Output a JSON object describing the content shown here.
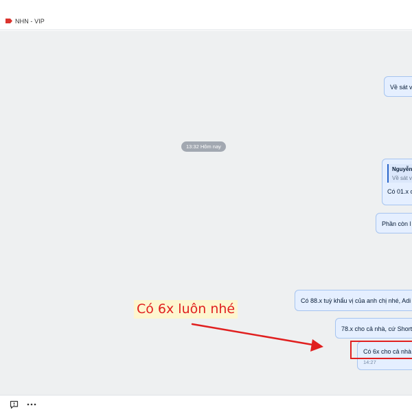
{
  "header": {
    "tag_color": "#db342e",
    "title": "NHN - VIP"
  },
  "chat": {
    "time_separator": "13:32 Hôm nay",
    "messages": [
      {
        "text": "Về sát v"
      },
      {
        "quote_name": "Nguyễn",
        "quote_text": "Về sát v",
        "text": "Có 01.x c"
      },
      {
        "text": "Phần còn l"
      },
      {
        "text": "Có 88.x tuỳ khẩu vị của anh chị nhé, Adi"
      },
      {
        "text": "78.x cho cả nhà, cứ Short"
      },
      {
        "text": "Có 6x cho cả nhà",
        "time": "14:27"
      }
    ]
  },
  "annotation": {
    "text": "Có 6x luôn nhé",
    "color": "#e01f1f",
    "highlight_color": "#fdf6cf"
  },
  "footer": {
    "icons": [
      "feedback-icon",
      "more-icon"
    ]
  }
}
